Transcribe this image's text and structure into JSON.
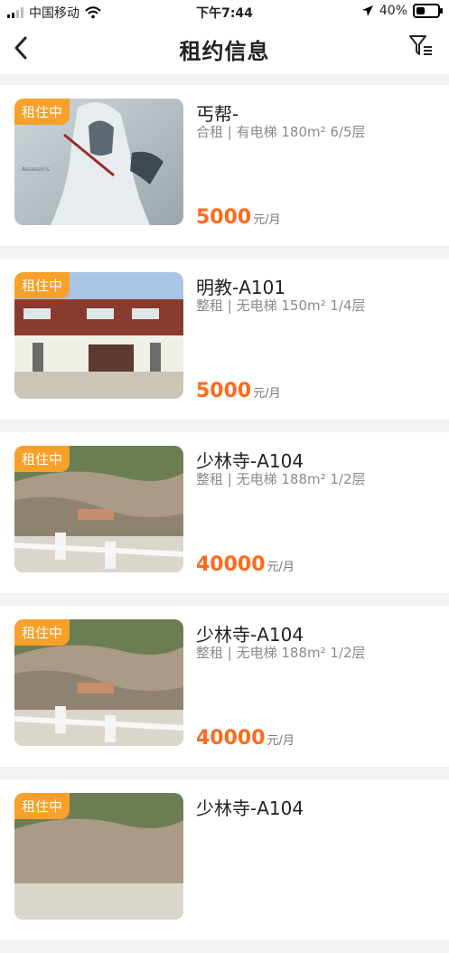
{
  "status_bar": {
    "carrier": "中国移动",
    "time": "下午7:44",
    "battery": "40%"
  },
  "header": {
    "title": "租约信息"
  },
  "listings": [
    {
      "badge": "租住中",
      "title": "丐帮-",
      "details": "合租 | 有电梯 180m² 6/5层",
      "price": "5000",
      "unit": "元/月",
      "image_icon": "character-photo"
    },
    {
      "badge": "租住中",
      "title": "明教-A101",
      "details": "整租 | 无电梯 150m² 1/4层",
      "price": "5000",
      "unit": "元/月",
      "image_icon": "building-photo"
    },
    {
      "badge": "租住中",
      "title": "少林寺-A104",
      "details": "整租 | 无电梯 188m² 1/2层",
      "price": "40000",
      "unit": "元/月",
      "image_icon": "rocks-photo"
    },
    {
      "badge": "租住中",
      "title": "少林寺-A104",
      "details": "整租 | 无电梯 188m² 1/2层",
      "price": "40000",
      "unit": "元/月",
      "image_icon": "rocks-photo"
    },
    {
      "badge": "租住中",
      "title": "少林寺-A104",
      "details": "",
      "price": "",
      "unit": "",
      "image_icon": "rocks-photo"
    }
  ],
  "colors": {
    "accent_price": "#ff6a1a",
    "badge_bg": "#f7a02a"
  }
}
